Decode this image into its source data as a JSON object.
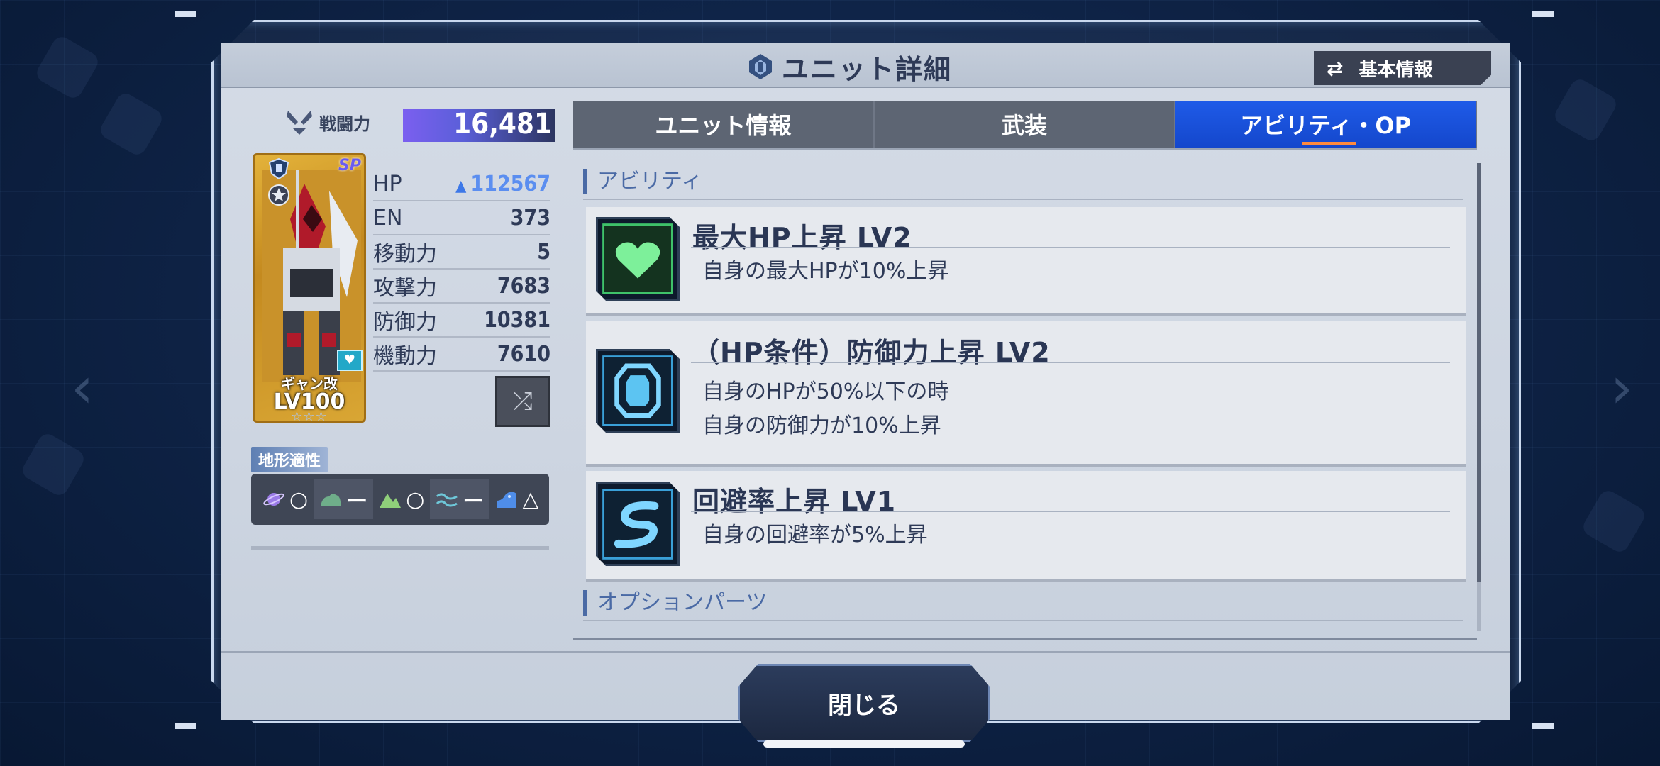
{
  "header": {
    "title": "ユニット詳細",
    "basic_info_button": "基本情報"
  },
  "unit": {
    "power_label": "戦闘力",
    "power_value": "16,481",
    "card_name": "ギャン改",
    "card_level": "LV100",
    "card_stars": "☆☆☆",
    "card_badge": "SP",
    "stats": [
      {
        "label": "HP",
        "value": "112567"
      },
      {
        "label": "EN",
        "value": "373"
      },
      {
        "label": "移動力",
        "value": "5"
      },
      {
        "label": "攻撃力",
        "value": "7683"
      },
      {
        "label": "防御力",
        "value": "10381"
      },
      {
        "label": "機動力",
        "value": "7610"
      }
    ]
  },
  "terrain": {
    "label": "地形適性",
    "items": [
      {
        "icon": "space-icon",
        "rank": "○"
      },
      {
        "icon": "air-icon",
        "rank": "ー"
      },
      {
        "icon": "ground-icon",
        "rank": "○"
      },
      {
        "icon": "water-icon",
        "rank": "ー"
      },
      {
        "icon": "underwater-icon",
        "rank": "△"
      }
    ]
  },
  "tabs": [
    {
      "label": "ユニット情報",
      "active": false
    },
    {
      "label": "武装",
      "active": false
    },
    {
      "label": "アビリティ・OP",
      "active": true
    }
  ],
  "abilities_header": "アビリティ",
  "abilities": [
    {
      "title": "最大HP上昇 LV2",
      "desc_lines": [
        "自身の最大HPが10%上昇"
      ],
      "icon": "heart-icon"
    },
    {
      "title": "（HP条件）防御力上昇 LV2",
      "desc_lines": [
        "自身のHPが50%以下の時",
        "自身の防御力が10%上昇"
      ],
      "icon": "shield-icon"
    },
    {
      "title": "回避率上昇 LV1",
      "desc_lines": [
        "自身の回避率が5%上昇"
      ],
      "icon": "evasion-icon"
    }
  ],
  "options_header": "オプションパーツ",
  "close_button": "閉じる",
  "colors": {
    "accent_blue": "#1f5be8",
    "tab_underline": "#ff8a3d",
    "hp_value": "#5b8ef0"
  }
}
